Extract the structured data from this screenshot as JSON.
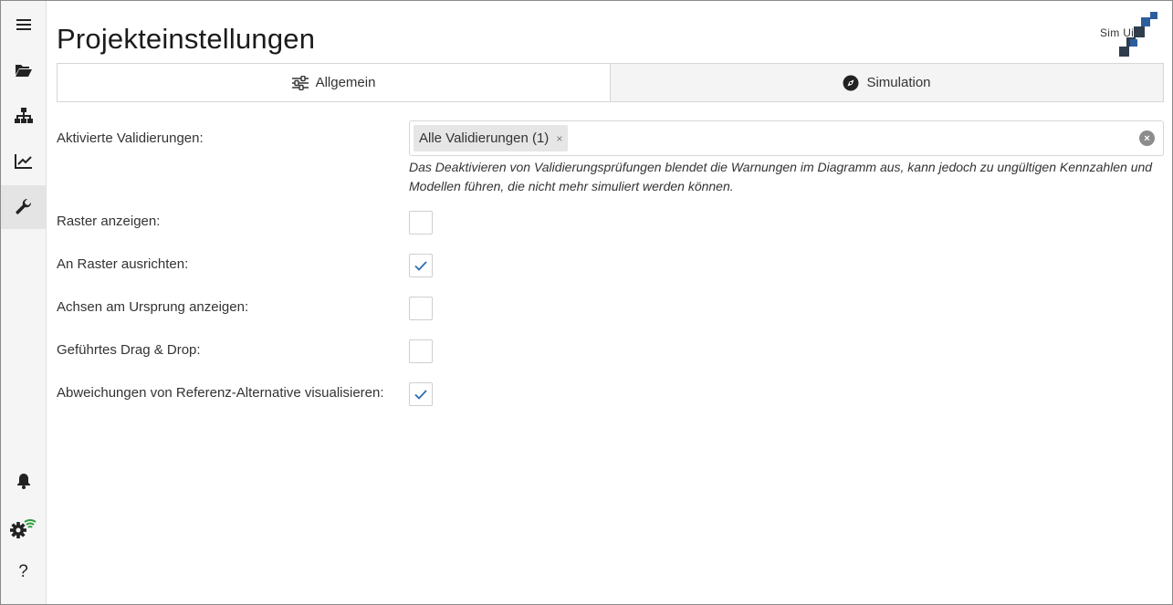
{
  "page": {
    "title": "Projekteinstellungen"
  },
  "logo": {
    "text": "Sim  Ui"
  },
  "sidebar": {
    "items": [
      {
        "name": "menu-icon"
      },
      {
        "name": "folder-open-icon"
      },
      {
        "name": "sitemap-icon"
      },
      {
        "name": "chart-line-icon"
      },
      {
        "name": "wrench-icon",
        "active": true
      },
      {
        "name": "bell-icon"
      },
      {
        "name": "settings-wifi-icon"
      },
      {
        "name": "help-icon",
        "label": "?"
      }
    ]
  },
  "tabs": [
    {
      "label": "Allgemein",
      "icon": "sliders-icon",
      "active": true
    },
    {
      "label": "Simulation",
      "icon": "compass-icon",
      "active": false
    }
  ],
  "settings": {
    "validations": {
      "label": "Aktivierte Validierungen:",
      "chip": "Alle Validierungen (1)",
      "chip_remove": "×",
      "clear": "×",
      "help": "Das Deaktivieren von Validierungsprüfungen blendet die Warnungen im Diagramm aus, kann jedoch zu ungültigen Kennzahlen und Modellen führen, die nicht mehr simuliert werden können."
    },
    "options": [
      {
        "label": "Raster anzeigen:",
        "checked": false
      },
      {
        "label": "An Raster ausrichten:",
        "checked": true
      },
      {
        "label": "Achsen am Ursprung anzeigen:",
        "checked": false
      },
      {
        "label": "Geführtes Drag & Drop:",
        "checked": false
      },
      {
        "label": "Abweichungen von Referenz-Alternative visualisieren:",
        "checked": true
      }
    ]
  },
  "colors": {
    "accent": "#2b6cb0",
    "logo_dark": "#2f3d4d",
    "logo_blue": "#2c5e9e",
    "wifi_green": "#2e9e3e"
  }
}
